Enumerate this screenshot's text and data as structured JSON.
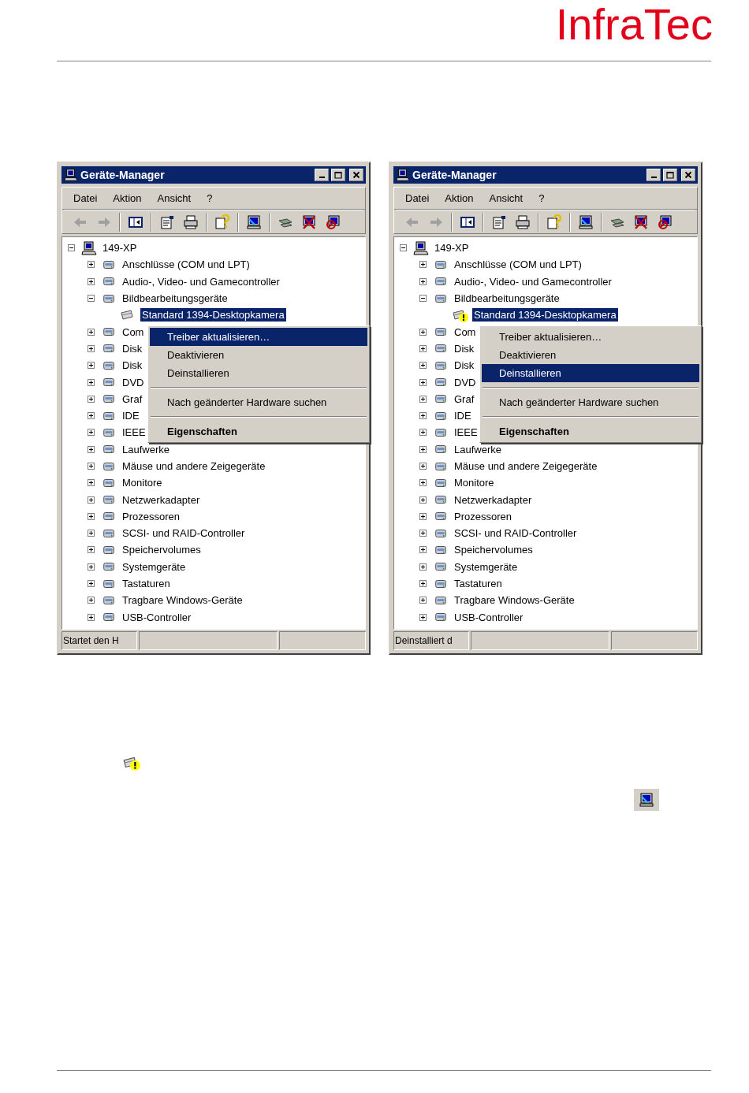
{
  "logo": {
    "text": "InfraTec"
  },
  "windows": [
    {
      "title": "Geräte-Manager",
      "menu": [
        "Datei",
        "Aktion",
        "Ansicht",
        "?"
      ],
      "tree": {
        "label": "149-XP",
        "expanded": true,
        "selected": false,
        "children": [
          {
            "label": "Anschlüsse (COM und LPT)",
            "expanded": false,
            "selected": false
          },
          {
            "label": "Audio-, Video- und Gamecontroller",
            "expanded": false,
            "selected": false
          },
          {
            "label": "Bildbearbeitungsgeräte",
            "expanded": true,
            "selected": false,
            "children": [
              {
                "label": "Standard 1394-Desktopkamera",
                "selected": true,
                "warning": false
              }
            ]
          },
          {
            "label": "Com",
            "expanded": false,
            "selected": false
          },
          {
            "label": "Disk",
            "expanded": false,
            "selected": false
          },
          {
            "label": "Disk",
            "expanded": false,
            "selected": false
          },
          {
            "label": "DVD",
            "expanded": false,
            "selected": false
          },
          {
            "label": "Graf",
            "expanded": false,
            "selected": false
          },
          {
            "label": "IDE",
            "expanded": false,
            "selected": false
          },
          {
            "label": "IEEE",
            "expanded": false,
            "selected": false
          },
          {
            "label": "Laufwerke",
            "expanded": false,
            "selected": false
          },
          {
            "label": "Mäuse und andere Zeigegeräte",
            "expanded": false,
            "selected": false
          },
          {
            "label": "Monitore",
            "expanded": false,
            "selected": false
          },
          {
            "label": "Netzwerkadapter",
            "expanded": false,
            "selected": false
          },
          {
            "label": "Prozessoren",
            "expanded": false,
            "selected": false
          },
          {
            "label": "SCSI- und RAID-Controller",
            "expanded": false,
            "selected": false
          },
          {
            "label": "Speichervolumes",
            "expanded": false,
            "selected": false
          },
          {
            "label": "Systemgeräte",
            "expanded": false,
            "selected": false
          },
          {
            "label": "Tastaturen",
            "expanded": false,
            "selected": false
          },
          {
            "label": "Tragbare Windows-Geräte",
            "expanded": false,
            "selected": false
          },
          {
            "label": "USB-Controller",
            "expanded": false,
            "selected": false
          }
        ]
      },
      "context_menu": [
        {
          "kind": "item",
          "label": "Treiber aktualisieren…",
          "selected": true
        },
        {
          "kind": "item",
          "label": "Deaktivieren",
          "selected": false
        },
        {
          "kind": "item",
          "label": "Deinstallieren",
          "selected": false
        },
        {
          "kind": "separator"
        },
        {
          "kind": "item",
          "label": "Nach geänderter Hardware suchen",
          "selected": false
        },
        {
          "kind": "separator"
        },
        {
          "kind": "item",
          "label": "Eigenschaften",
          "selected": false,
          "bold": true
        }
      ],
      "status_bar": {
        "text": "Startet den H"
      }
    },
    {
      "title": "Geräte-Manager",
      "menu": [
        "Datei",
        "Aktion",
        "Ansicht",
        "?"
      ],
      "tree": {
        "label": "149-XP",
        "expanded": true,
        "selected": false,
        "children": [
          {
            "label": "Anschlüsse (COM und LPT)",
            "expanded": false,
            "selected": false
          },
          {
            "label": "Audio-, Video- und Gamecontroller",
            "expanded": false,
            "selected": false
          },
          {
            "label": "Bildbearbeitungsgeräte",
            "expanded": true,
            "selected": false,
            "children": [
              {
                "label": "Standard 1394-Desktopkamera",
                "selected": true,
                "warning": true
              }
            ]
          },
          {
            "label": "Com",
            "expanded": false,
            "selected": false
          },
          {
            "label": "Disk",
            "expanded": false,
            "selected": false
          },
          {
            "label": "Disk",
            "expanded": false,
            "selected": false
          },
          {
            "label": "DVD",
            "expanded": false,
            "selected": false
          },
          {
            "label": "Graf",
            "expanded": false,
            "selected": false
          },
          {
            "label": "IDE",
            "expanded": false,
            "selected": false
          },
          {
            "label": "IEEE",
            "expanded": false,
            "selected": false
          },
          {
            "label": "Laufwerke",
            "expanded": false,
            "selected": false
          },
          {
            "label": "Mäuse und andere Zeigegeräte",
            "expanded": false,
            "selected": false
          },
          {
            "label": "Monitore",
            "expanded": false,
            "selected": false
          },
          {
            "label": "Netzwerkadapter",
            "expanded": false,
            "selected": false
          },
          {
            "label": "Prozessoren",
            "expanded": false,
            "selected": false
          },
          {
            "label": "SCSI- und RAID-Controller",
            "expanded": false,
            "selected": false
          },
          {
            "label": "Speichervolumes",
            "expanded": false,
            "selected": false
          },
          {
            "label": "Systemgeräte",
            "expanded": false,
            "selected": false
          },
          {
            "label": "Tastaturen",
            "expanded": false,
            "selected": false
          },
          {
            "label": "Tragbare Windows-Geräte",
            "expanded": false,
            "selected": false
          },
          {
            "label": "USB-Controller",
            "expanded": false,
            "selected": false
          }
        ]
      },
      "context_menu": [
        {
          "kind": "item",
          "label": "Treiber aktualisieren…",
          "selected": false
        },
        {
          "kind": "item",
          "label": "Deaktivieren",
          "selected": false
        },
        {
          "kind": "item",
          "label": "Deinstallieren",
          "selected": true
        },
        {
          "kind": "separator"
        },
        {
          "kind": "item",
          "label": "Nach geänderter Hardware suchen",
          "selected": false
        },
        {
          "kind": "separator"
        },
        {
          "kind": "item",
          "label": "Eigenschaften",
          "selected": false,
          "bold": true
        }
      ],
      "status_bar": {
        "text": "Deinstalliert d"
      }
    }
  ]
}
